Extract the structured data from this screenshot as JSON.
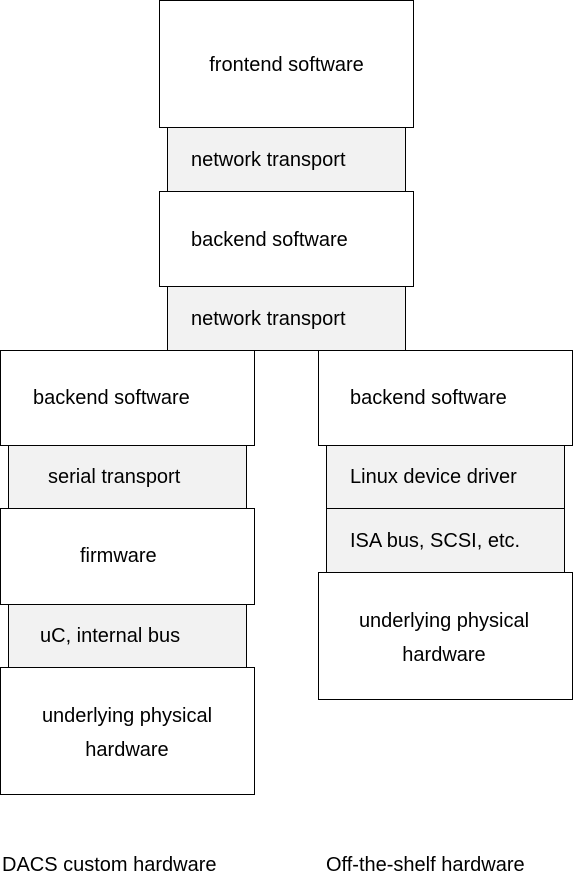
{
  "boxes": {
    "frontend": "frontend software",
    "net1": "network transport",
    "backend_top": "backend software",
    "net2": "network transport",
    "left_backend": "backend software",
    "serial": "serial transport",
    "firmware": "firmware",
    "uc_bus": "uC, internal bus",
    "left_hw_line1": "underlying physical",
    "left_hw_line2": "hardware",
    "right_backend": "backend software",
    "linux_driver": "Linux device driver",
    "isa_bus": "ISA bus, SCSI, etc.",
    "right_hw_line1": "underlying physical",
    "right_hw_line2": "hardware"
  },
  "labels": {
    "left": "DACS custom hardware",
    "right": "Off-the-shelf hardware"
  },
  "colors": {
    "transport_fill": "#f2f2f2",
    "box_fill": "#ffffff",
    "border": "#000000"
  }
}
